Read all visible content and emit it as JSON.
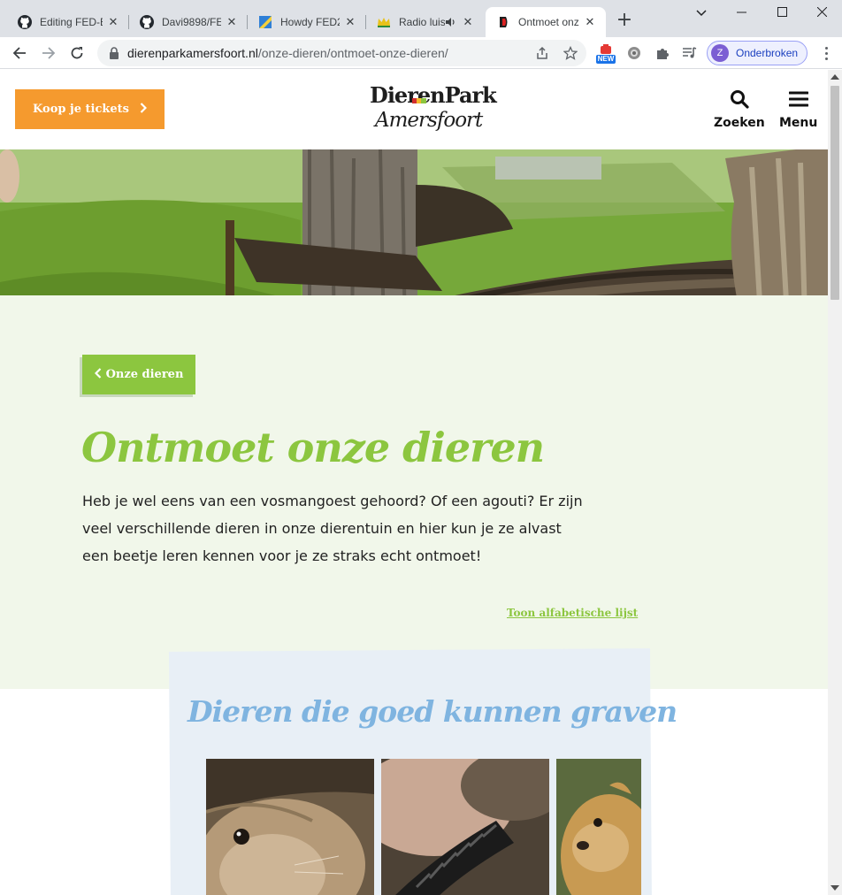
{
  "browser": {
    "tabs": [
      {
        "title": "Editing FED-E",
        "icon": "github-icon"
      },
      {
        "title": "Davi9898/FED",
        "icon": "github-icon"
      },
      {
        "title": "Howdy FED2",
        "icon": "howdy-icon"
      },
      {
        "title": "Radio luis",
        "icon": "crown-icon"
      },
      {
        "title": "Ontmoet onz",
        "icon": "dierenpark-icon",
        "active": true
      }
    ],
    "address": {
      "domain": "dierenparkamersfoort.nl",
      "path": "/onze-dieren/ontmoet-onze-dieren/"
    },
    "extension_badge": "NEW",
    "profile": {
      "initial": "Z",
      "name": "Onderbroken"
    }
  },
  "site": {
    "ticket_button": "Koop je tickets",
    "logo": {
      "line1": "DierenPark",
      "line2": "Amersfoort"
    },
    "search_label": "Zoeken",
    "menu_label": "Menu",
    "back_button": "Onze dieren",
    "title": "Ontmoet onze dieren",
    "intro": "Heb je wel eens van een vosmangoest gehoord? Of een agouti? Er zijn veel verschillende dieren in onze dierentuin en hier kun je ze alvast een beetje leren kennen voor je ze straks echt ontmoet!",
    "alpha_link": "Toon alfabetische lijst",
    "section_title": "Dieren die goed kunnen graven",
    "colors": {
      "accent_green": "#8cc63f",
      "orange": "#f59a2e",
      "light_green_bg": "#f1f7ea",
      "card_blue": "#e8eff6",
      "title_blue": "#7fb4e0"
    }
  }
}
